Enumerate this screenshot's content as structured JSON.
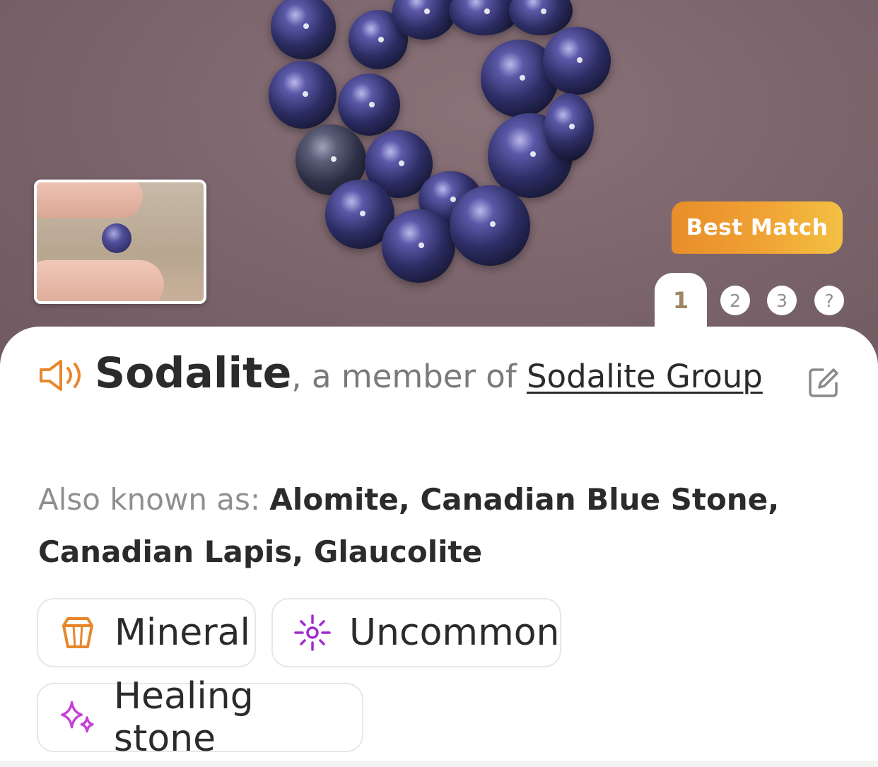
{
  "hero": {
    "badge": "Best Match",
    "tabs": [
      "1",
      "2",
      "3",
      "?"
    ]
  },
  "result": {
    "name": "Sodalite",
    "member_text": ", a member of ",
    "group": "Sodalite Group",
    "aka_label": "Also known as: ",
    "aka_values": "Alomite, Canadian Blue Stone, Canadian Lapis, Glaucolite"
  },
  "chips": [
    {
      "label": "Mineral",
      "icon": "crystal-icon",
      "color": "#e8872d"
    },
    {
      "label": "Uncommon",
      "icon": "sparkle-burst-icon",
      "color": "#a02bd0"
    },
    {
      "label": "Healing stone",
      "icon": "sparkles-icon",
      "color": "#c63fd6"
    }
  ],
  "colors": {
    "accent_orange": "#e88d2a",
    "text_dark": "#2b2b2b",
    "text_muted": "#8f8f8f"
  }
}
